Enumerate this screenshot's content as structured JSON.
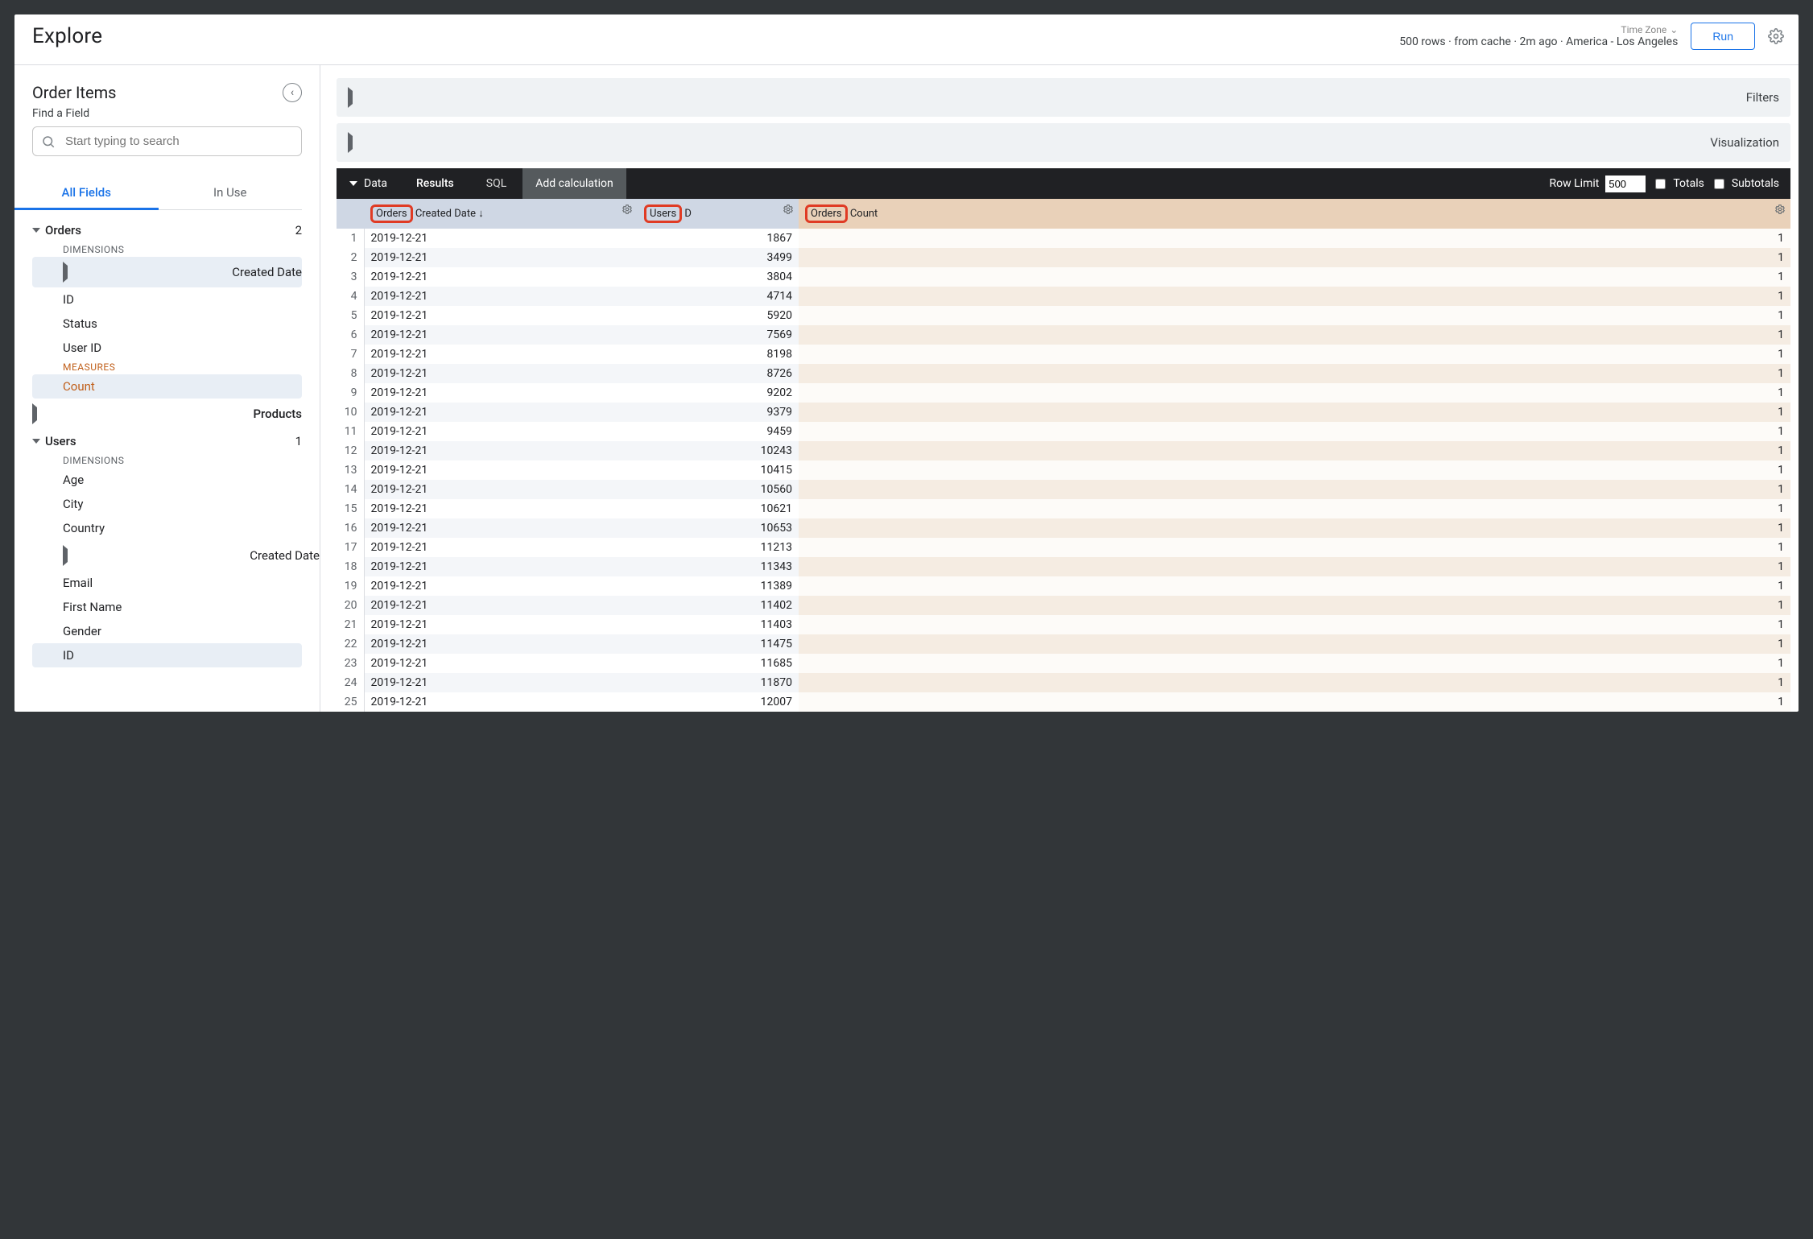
{
  "header": {
    "title": "Explore",
    "timezone_label": "Time Zone",
    "meta": "500 rows · from cache · 2m ago · America - Los Angeles",
    "run_label": "Run"
  },
  "left_panel": {
    "explore_name": "Order Items",
    "find_label": "Find a Field",
    "search_placeholder": "Start typing to search",
    "tab_all": "All Fields",
    "tab_inuse": "In Use",
    "groups": {
      "orders": {
        "label": "Orders",
        "count": "2"
      },
      "products": {
        "label": "Products"
      },
      "users": {
        "label": "Users",
        "count": "1"
      }
    },
    "labels": {
      "dimensions": "DIMENSIONS",
      "measures": "MEASURES"
    },
    "orders_fields": {
      "created_date": "Created Date",
      "id": "ID",
      "status": "Status",
      "user_id": "User ID",
      "count": "Count"
    },
    "users_fields": {
      "age": "Age",
      "city": "City",
      "country": "Country",
      "created_date": "Created Date",
      "email": "Email",
      "first_name": "First Name",
      "gender": "Gender",
      "id": "ID"
    }
  },
  "panels": {
    "filters": "Filters",
    "visualization": "Visualization"
  },
  "data_bar": {
    "data_label": "Data",
    "tab_results": "Results",
    "tab_sql": "SQL",
    "add_calc": "Add calculation",
    "row_limit_label": "Row Limit",
    "row_limit_value": "500",
    "totals": "Totals",
    "subtotals": "Subtotals"
  },
  "cols": {
    "c0_pref": "Orders",
    "c0_name": "Created Date",
    "c1_pref": "Users",
    "c1_name": "D",
    "c2_pref": "Orders",
    "c2_name": "Count"
  },
  "rows": [
    {
      "n": "1",
      "d": "2019-12-21",
      "u": "1867",
      "c": "1"
    },
    {
      "n": "2",
      "d": "2019-12-21",
      "u": "3499",
      "c": "1"
    },
    {
      "n": "3",
      "d": "2019-12-21",
      "u": "3804",
      "c": "1"
    },
    {
      "n": "4",
      "d": "2019-12-21",
      "u": "4714",
      "c": "1"
    },
    {
      "n": "5",
      "d": "2019-12-21",
      "u": "5920",
      "c": "1"
    },
    {
      "n": "6",
      "d": "2019-12-21",
      "u": "7569",
      "c": "1"
    },
    {
      "n": "7",
      "d": "2019-12-21",
      "u": "8198",
      "c": "1"
    },
    {
      "n": "8",
      "d": "2019-12-21",
      "u": "8726",
      "c": "1"
    },
    {
      "n": "9",
      "d": "2019-12-21",
      "u": "9202",
      "c": "1"
    },
    {
      "n": "10",
      "d": "2019-12-21",
      "u": "9379",
      "c": "1"
    },
    {
      "n": "11",
      "d": "2019-12-21",
      "u": "9459",
      "c": "1"
    },
    {
      "n": "12",
      "d": "2019-12-21",
      "u": "10243",
      "c": "1"
    },
    {
      "n": "13",
      "d": "2019-12-21",
      "u": "10415",
      "c": "1"
    },
    {
      "n": "14",
      "d": "2019-12-21",
      "u": "10560",
      "c": "1"
    },
    {
      "n": "15",
      "d": "2019-12-21",
      "u": "10621",
      "c": "1"
    },
    {
      "n": "16",
      "d": "2019-12-21",
      "u": "10653",
      "c": "1"
    },
    {
      "n": "17",
      "d": "2019-12-21",
      "u": "11213",
      "c": "1"
    },
    {
      "n": "18",
      "d": "2019-12-21",
      "u": "11343",
      "c": "1"
    },
    {
      "n": "19",
      "d": "2019-12-21",
      "u": "11389",
      "c": "1"
    },
    {
      "n": "20",
      "d": "2019-12-21",
      "u": "11402",
      "c": "1"
    },
    {
      "n": "21",
      "d": "2019-12-21",
      "u": "11403",
      "c": "1"
    },
    {
      "n": "22",
      "d": "2019-12-21",
      "u": "11475",
      "c": "1"
    },
    {
      "n": "23",
      "d": "2019-12-21",
      "u": "11685",
      "c": "1"
    },
    {
      "n": "24",
      "d": "2019-12-21",
      "u": "11870",
      "c": "1"
    },
    {
      "n": "25",
      "d": "2019-12-21",
      "u": "12007",
      "c": "1"
    }
  ]
}
